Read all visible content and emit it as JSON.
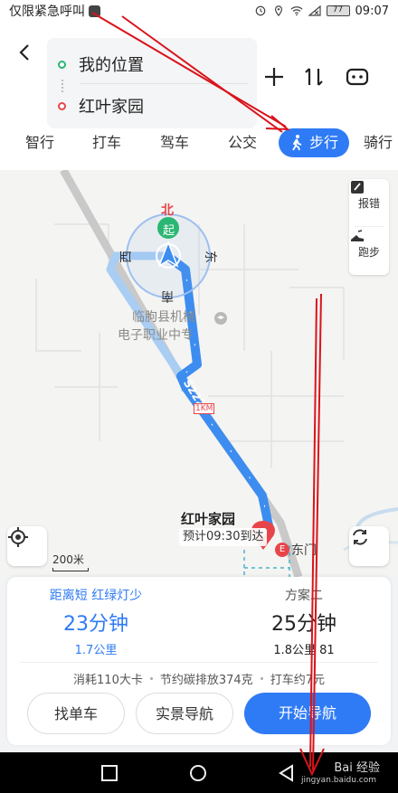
{
  "status_bar": {
    "carrier": "仅限紧急呼叫",
    "battery": "77",
    "time": "09:07"
  },
  "route": {
    "start": "我的位置",
    "end": "红叶家园",
    "back_icon": "chevron-left-icon",
    "add_icon": "plus-icon",
    "swap_icon": "swap-icon",
    "more_icon": "more-icon"
  },
  "modes": [
    {
      "label": "智行"
    },
    {
      "label": "打车"
    },
    {
      "label": "驾车"
    },
    {
      "label": "公交"
    },
    {
      "label": "步行",
      "active": true
    },
    {
      "label": "骑行"
    }
  ],
  "map": {
    "poi_line1": "临朐县机械",
    "poi_line2": "电子职业中专",
    "road_label": "S222",
    "km_badge": "1KM",
    "compass": {
      "north": "北",
      "east": "东",
      "south": "南",
      "west": "西",
      "start": "起"
    },
    "tools": [
      {
        "label": "报错",
        "icon": "edit-icon"
      },
      {
        "label": "跑步",
        "icon": "running-shoe-icon"
      }
    ],
    "scale": "200米",
    "destination": "红叶家园",
    "eta": "预计09:30到达",
    "gate": "东门",
    "gate_marker": "E"
  },
  "options": [
    {
      "tag": "距离短 红绿灯少",
      "time": "23分钟",
      "distance": "1.7公里",
      "selected": true
    },
    {
      "tag": "方案二",
      "time": "25分钟",
      "distance": "1.8公里 81"
    }
  ],
  "stats": {
    "calories": "消耗110大卡",
    "carbon": "节约碳排放374克",
    "taxi": "打车约7元"
  },
  "buttons": {
    "bike": "找单车",
    "ar_nav": "实景导航",
    "start_nav": "开始导航"
  },
  "watermark": {
    "brand": "Bai 经验",
    "url": "jingyan.baidu.com"
  },
  "colors": {
    "accent": "#2f7bf5",
    "route": "#3d8df0",
    "start": "#2bb673",
    "end": "#e8454a",
    "annotation": "#d9141b"
  }
}
